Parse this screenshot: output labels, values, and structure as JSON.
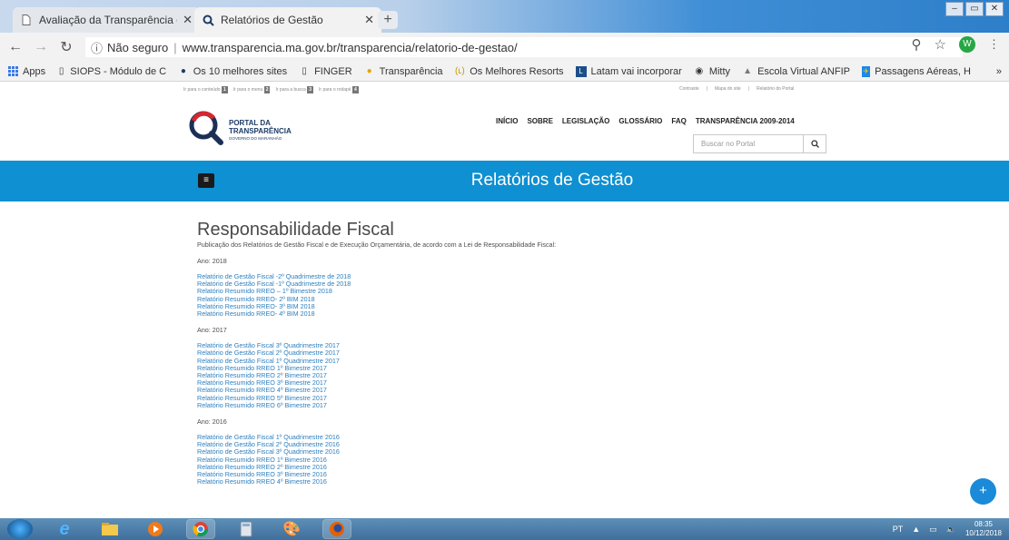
{
  "browser": {
    "tabs": [
      {
        "label": "Avaliação da Transparência dos",
        "active": false,
        "icon": "document-icon"
      },
      {
        "label": "Relatórios de Gestão",
        "active": true,
        "icon": "search-favicon"
      }
    ],
    "address": {
      "secure_label": "Não seguro",
      "url": "www.transparencia.ma.gov.br/transparencia/relatorio-de-gestao/"
    },
    "profile_initial": "W",
    "bookmarks": [
      {
        "label": "Apps",
        "icon": "apps-grid-icon"
      },
      {
        "label": "SIOPS - Módulo de C",
        "icon": "document-icon"
      },
      {
        "label": "Os 10 melhores sites",
        "icon": "circle-icon"
      },
      {
        "label": "FINGER",
        "icon": "document-icon"
      },
      {
        "label": "Transparência",
        "icon": "info-icon"
      },
      {
        "label": "Os Melhores Resorts",
        "icon": "bookmark-icon"
      },
      {
        "label": "Latam vai incorporar",
        "icon": "latam-icon"
      },
      {
        "label": "Mitty",
        "icon": "eye-icon"
      },
      {
        "label": "Escola Virtual ANFIP",
        "icon": "school-icon"
      },
      {
        "label": "Passagens Aéreas, H",
        "icon": "plane-icon"
      }
    ]
  },
  "site": {
    "access_links": [
      "Ir para o conteúdo",
      "Ir para o menu",
      "Ir para a busca",
      "Ir para o rodapé"
    ],
    "access_keys": [
      "1",
      "2",
      "3",
      "4"
    ],
    "access_right": [
      "Contraste",
      "Mapa do site",
      "Relatório do Portal"
    ],
    "logo": {
      "line1": "PORTAL DA",
      "line2": "TRANSPARÊNCIA",
      "line3": "GOVERNO DO MARANHÃO"
    },
    "nav": [
      "INÍCIO",
      "SOBRE",
      "LEGISLAÇÃO",
      "GLOSSÁRIO",
      "FAQ",
      "TRANSPARÊNCIA 2009-2014"
    ],
    "search_placeholder": "Buscar no Portal",
    "banner_title": "Relatórios de Gestão",
    "heading": "Responsabilidade Fiscal",
    "intro": "Publicação dos Relatórios de Gestão Fiscal e de Execução Orçamentária, de acordo com a Lei de Responsabilidade Fiscal:",
    "years": [
      {
        "label": "Ano: 2018",
        "links": [
          "Relatório de Gestão Fiscal -2º Quadrimestre de 2018",
          "Relatório de Gestão Fiscal -1º Quadrimestre de 2018",
          "Relatório Resumido RREO – 1º Bimestre 2018",
          "Relatório Resumido RREO- 2º BIM 2018",
          "Relatório Resumido RREO- 3º BIM 2018",
          "Relatório Resumido RREO- 4º BIM 2018"
        ]
      },
      {
        "label": "Ano: 2017",
        "links": [
          "Relatório de Gestão Fiscal 3º Quadrimestre 2017",
          "Relatório de Gestão Fiscal 2º Quadrimestre 2017",
          "Relatório de Gestão Fiscal 1º Quadrimestre 2017",
          "Relatório Resumido RREO 1º Bimestre 2017",
          "Relatório Resumido RREO 2º Bimestre 2017",
          "Relatório Resumido RREO 3º Bimestre 2017",
          "Relatório Resumido RREO 4º Bimestre 2017",
          "Relatório Resumido RREO 5º Bimestre 2017",
          "Relatório Resumido RREO 6º Bimestre 2017"
        ]
      },
      {
        "label": "Ano: 2016",
        "links": [
          "Relatório de Gestão Fiscal 1º Quadrimestre 2016",
          "Relatório de Gestão Fiscal 2º Quadrimestre 2016",
          "Relatório de Gestão Fiscal 3º Quadrimestre 2016",
          "Relatório Resumido RREO 1º Bimestre 2016",
          "Relatório Resumido RREO 2º Bimestre 2016",
          "Relatório Resumido RREO 3º Bimestre 2016",
          "Relatório Resumido RREO 4º Bimestre 2016"
        ]
      }
    ],
    "fab_label": "+"
  },
  "taskbar": {
    "language": "PT",
    "time": "08:35",
    "date": "10/12/2018"
  },
  "colors": {
    "banner": "#0e90d2",
    "link": "#2c7fc0",
    "fab": "#1b8ad9"
  }
}
